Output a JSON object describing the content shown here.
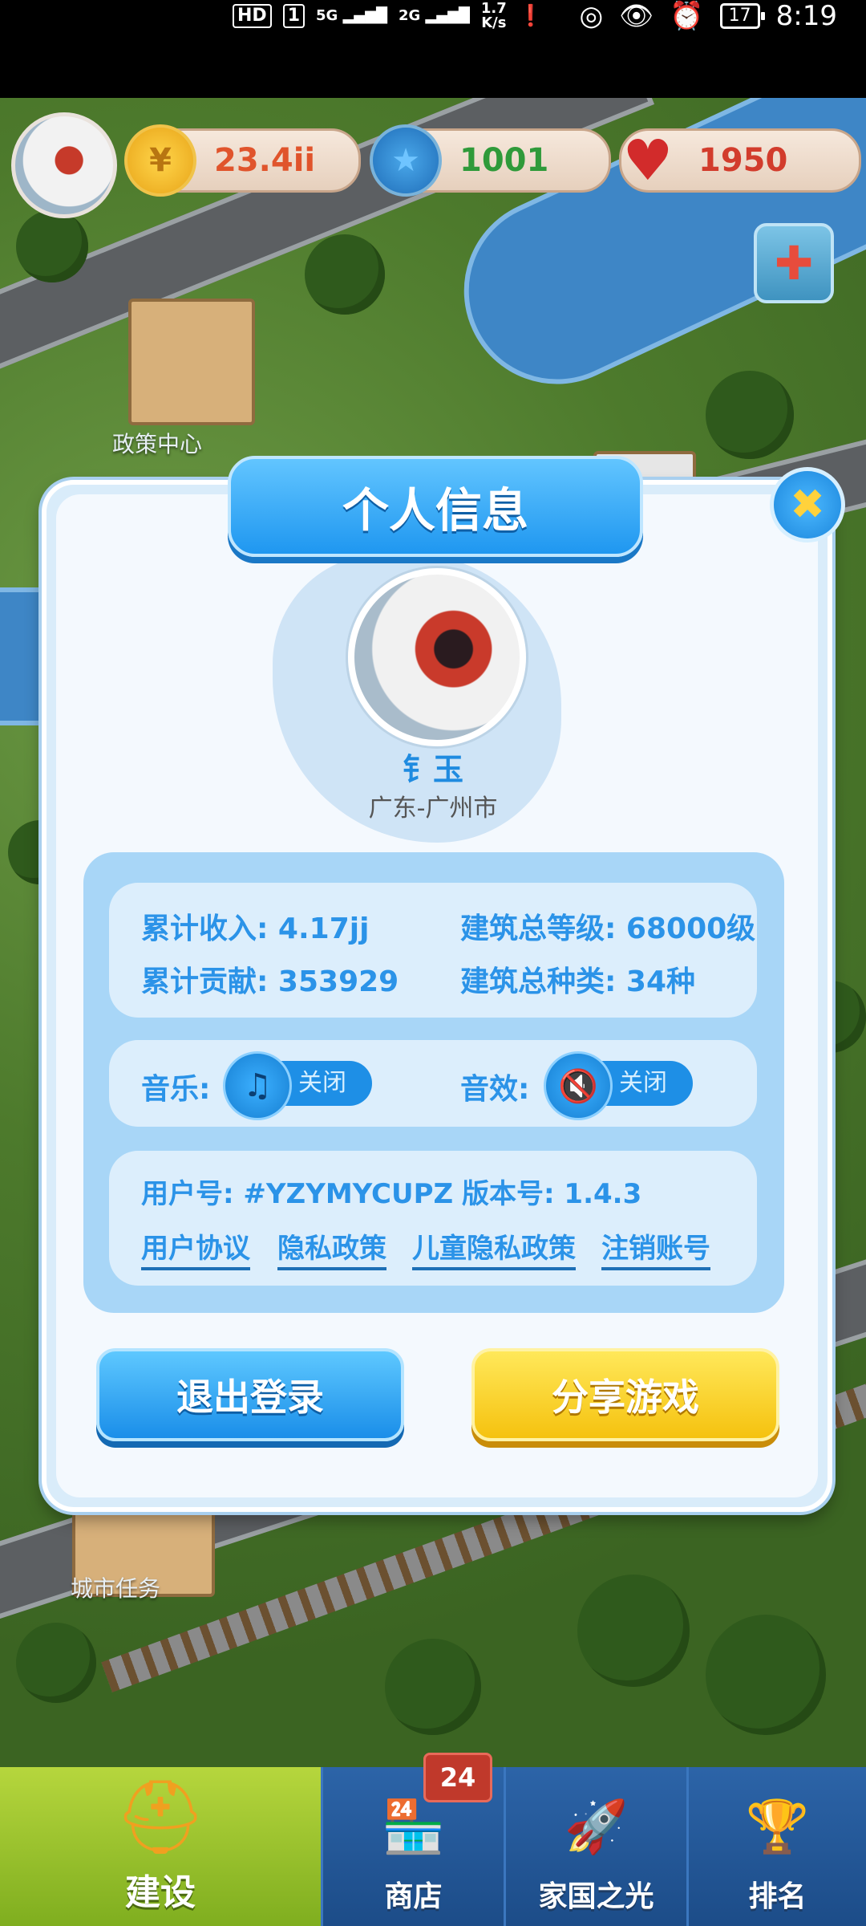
{
  "status_bar": {
    "left_badges": [
      "HD",
      "1"
    ],
    "network_1": "5G",
    "network_2": "2G",
    "speed": "1.7\nK/s",
    "time": "8:19",
    "battery": "17"
  },
  "resources": {
    "coins": "23.4ii",
    "stars": "1001",
    "hearts": "1950",
    "coin_icon": "coin-icon",
    "star_icon": "star-icon",
    "heart_icon": "heart-icon"
  },
  "map_labels": {
    "policy_center": "政策中心",
    "city_tasks": "城市任务"
  },
  "dialog": {
    "title": "个人信息",
    "username": "钅玉",
    "location": "广东-广州市",
    "stats": {
      "total_income": "累计收入: 4.17jj",
      "total_level": "建筑总等级: 68000级",
      "total_contribution": "累计贡献: 353929",
      "total_types": "建筑总种类: 34种"
    },
    "settings": {
      "music_label": "音乐:",
      "music_state": "关闭",
      "sound_label": "音效:",
      "sound_state": "关闭"
    },
    "account": {
      "user_id": "用户号: #YZYMYCUPZ",
      "version": "版本号: 1.4.3",
      "links": [
        "用户协议",
        "隐私政策",
        "儿童隐私政策",
        "注销账号"
      ]
    },
    "buttons": {
      "logout": "退出登录",
      "share": "分享游戏"
    }
  },
  "bottom_nav": {
    "items": [
      {
        "label": "建设",
        "icon": "hardhat-icon"
      },
      {
        "label": "商店",
        "icon": "shop-icon"
      },
      {
        "label": "家国之光",
        "icon": "rocket-icon"
      },
      {
        "label": "排名",
        "icon": "ranking-icon"
      }
    ],
    "shop_badge": "24"
  },
  "colors": {
    "primary_blue": "#2b93e8",
    "button_yellow": "#f5c20f",
    "nav_green": "#9cc42f",
    "nav_blue": "#24589a"
  }
}
